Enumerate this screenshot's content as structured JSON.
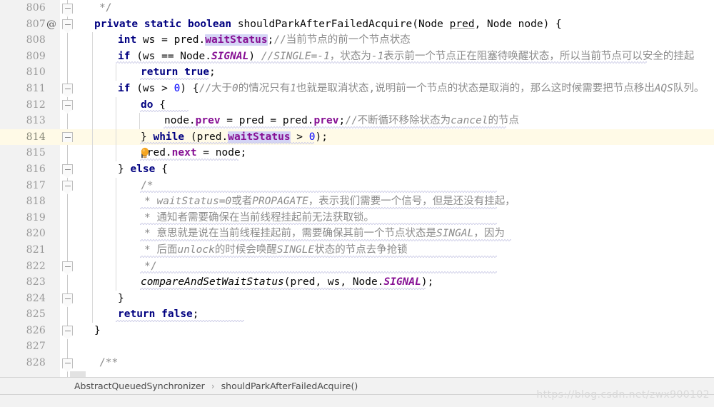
{
  "editor": {
    "file_class": "AbstractQueuedSynchronizer",
    "current_line": 814,
    "first_line": 806,
    "last_line": 828,
    "colors": {
      "keyword": "#000080",
      "field": "#871094",
      "number": "#0000ff",
      "comment": "#8c8c8c",
      "current_line_bg": "#fffae7",
      "gutter_bg": "#f2f2f2",
      "identifier_highlight": "#d4d4f5"
    },
    "gutter": {
      "annotation_marker": "@",
      "intention_bulb_line": 814
    },
    "lines": [
      {
        "n": "806",
        "text": "*/"
      },
      {
        "n": "807",
        "text": "private static boolean shouldParkAfterFailedAcquire(Node pred, Node node) {"
      },
      {
        "n": "808",
        "text": "int ws = pred.waitStatus;//当前节点的前一个节点状态"
      },
      {
        "n": "809",
        "text": "if (ws == Node.SIGNAL) //SINGLE=-1，状态为-1表示前一个节点正在阻塞待唤醒状态，所以当前节点可以安全的挂起"
      },
      {
        "n": "810",
        "text": "return true;"
      },
      {
        "n": "811",
        "text": "if (ws > 0) {//大于0的情况只有1也就是取消状态,说明前一个节点的状态是取消的，那么这时候需要把节点移出AQS队列。"
      },
      {
        "n": "812",
        "text": "do {"
      },
      {
        "n": "813",
        "text": "node.prev = pred = pred.prev;//不断循环移除状态为cancel的节点"
      },
      {
        "n": "814",
        "text": "} while (pred.waitStatus > 0);"
      },
      {
        "n": "815",
        "text": "pred.next = node;"
      },
      {
        "n": "816",
        "text": "} else {"
      },
      {
        "n": "817",
        "text": "/*"
      },
      {
        "n": "818",
        "text": "* waitStatus=0或者PROPAGATE，表示我们需要一个信号，但是还没有挂起，"
      },
      {
        "n": "819",
        "text": "* 通知者需要确保在当前线程挂起前无法获取锁。"
      },
      {
        "n": "820",
        "text": "* 意思就是说在当前线程挂起前，需要确保其前一个节点状态是SINGAL，因为"
      },
      {
        "n": "821",
        "text": "* 后面unlock的时候会唤醒SINGLE状态的节点去争抢锁"
      },
      {
        "n": "822",
        "text": "*/"
      },
      {
        "n": "823",
        "text": "compareAndSetWaitStatus(pred, ws, Node.SIGNAL);"
      },
      {
        "n": "824",
        "text": "}"
      },
      {
        "n": "825",
        "text": "return false;"
      },
      {
        "n": "826",
        "text": "}"
      },
      {
        "n": "827",
        "text": ""
      },
      {
        "n": "828",
        "text": "/**"
      }
    ]
  },
  "breadcrumb": {
    "class_name": "AbstractQueuedSynchronizer",
    "separator": "›",
    "method_name": "shouldParkAfterFailedAcquire()"
  },
  "watermark": {
    "text": "https://blog.csdn.net/zwx900102"
  }
}
